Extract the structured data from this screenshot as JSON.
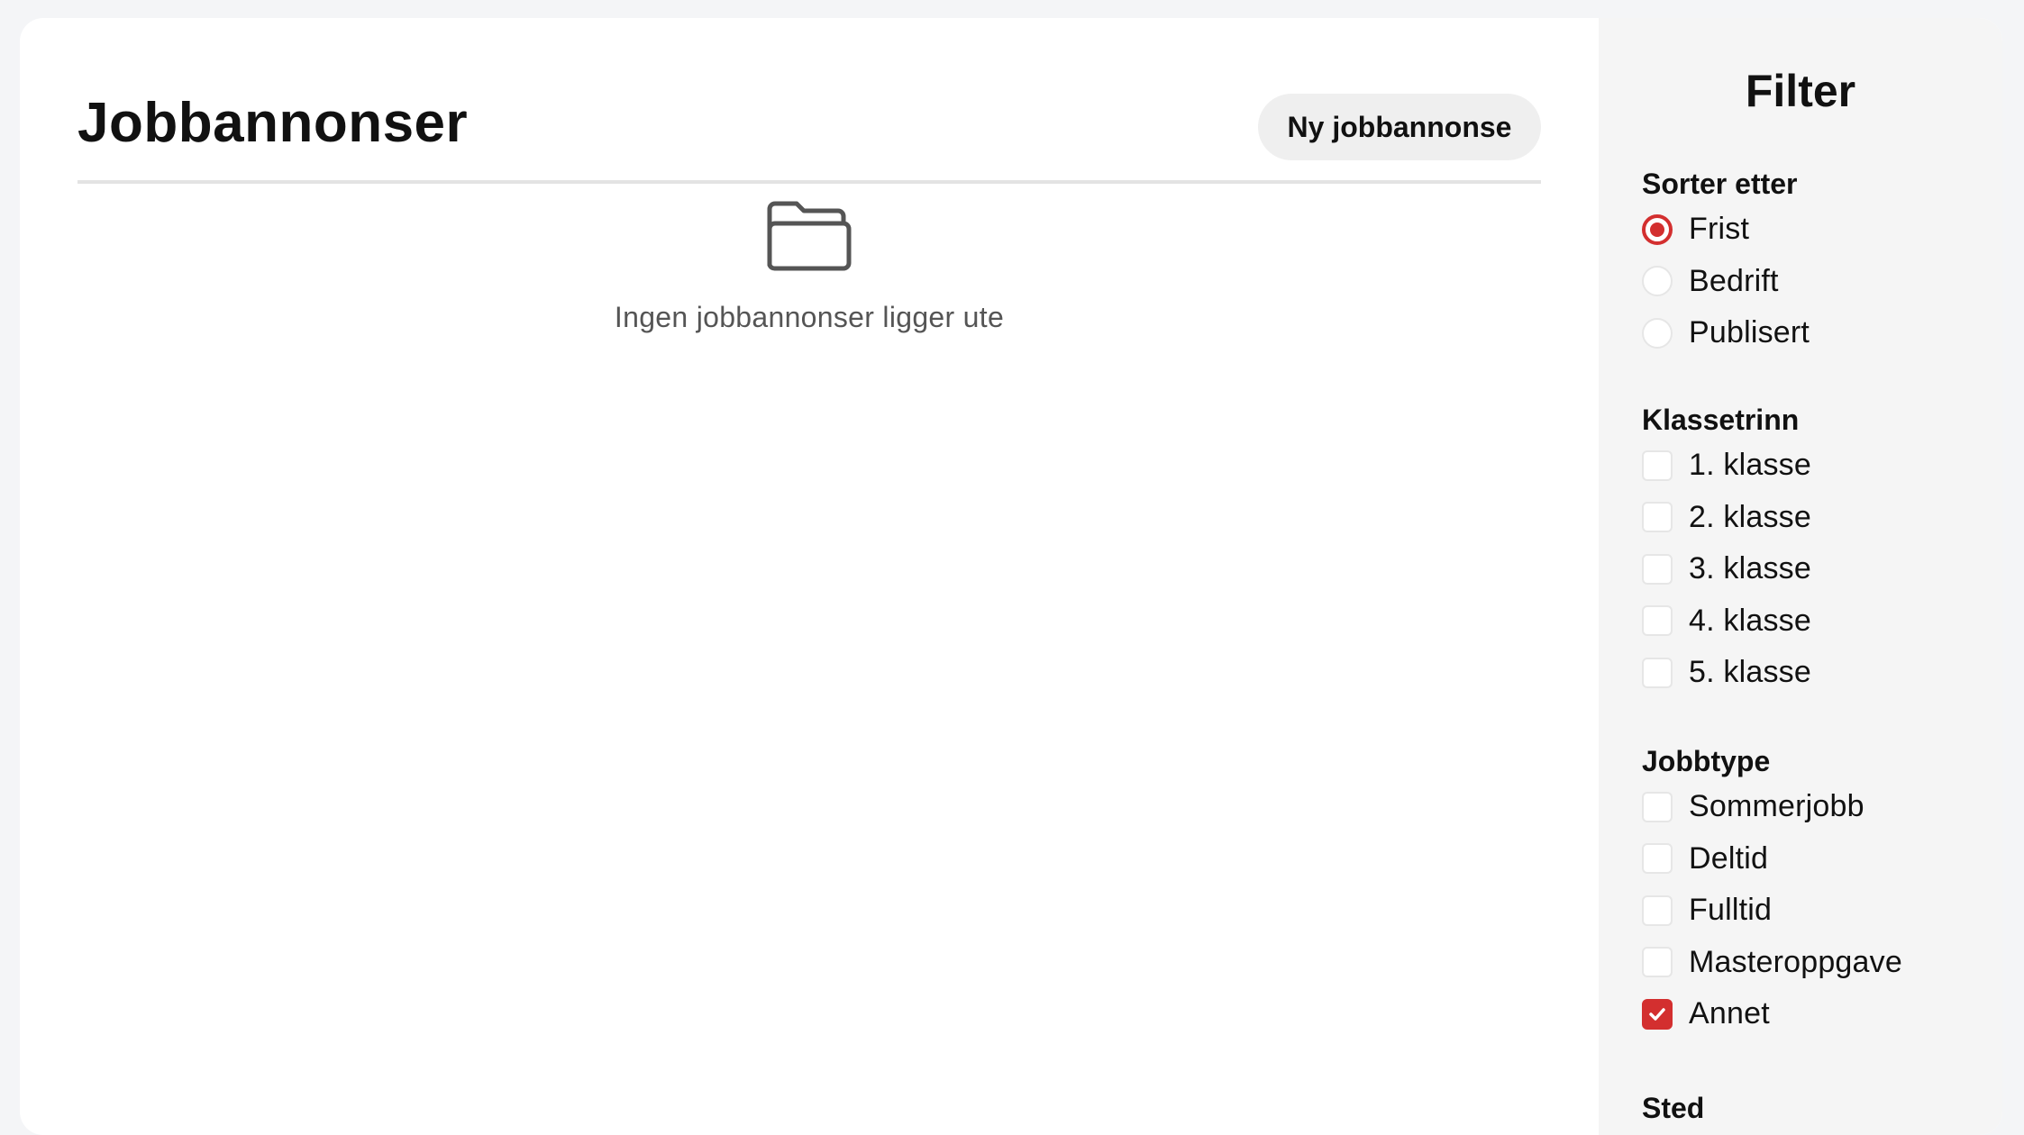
{
  "header": {
    "title": "Jobbannonser",
    "new_button_label": "Ny jobbannonse"
  },
  "empty_state": {
    "icon": "folder-open-icon",
    "text": "Ingen jobbannonser ligger ute"
  },
  "filter": {
    "title": "Filter",
    "sort": {
      "title": "Sorter etter",
      "options": [
        "Frist",
        "Bedrift",
        "Publisert"
      ],
      "selected": "Frist"
    },
    "class_level": {
      "title": "Klassetrinn",
      "options": [
        "1. klasse",
        "2. klasse",
        "3. klasse",
        "4. klasse",
        "5. klasse"
      ],
      "checked": []
    },
    "job_type": {
      "title": "Jobbtype",
      "options": [
        "Sommerjobb",
        "Deltid",
        "Fulltid",
        "Masteroppgave",
        "Annet"
      ],
      "checked": [
        "Annet"
      ]
    },
    "location": {
      "title": "Sted"
    }
  },
  "colors": {
    "accent": "#d32f2f",
    "sidebar_bg": "#f5f5f5",
    "page_bg": "#ffffff",
    "button_bg": "#efefef"
  }
}
